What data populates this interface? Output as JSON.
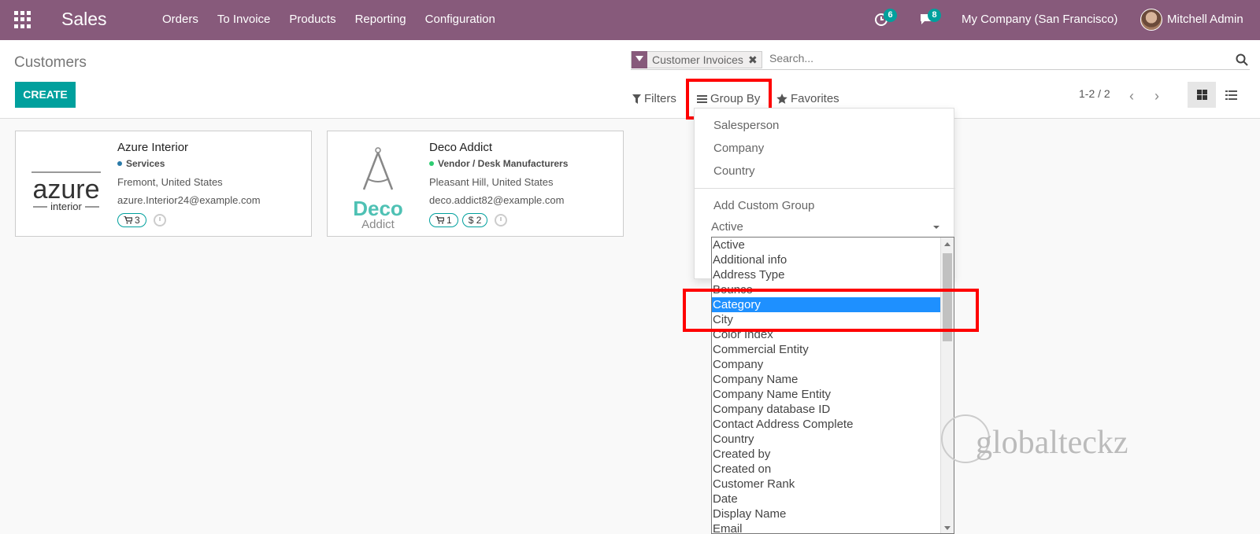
{
  "navbar": {
    "app_name": "Sales",
    "menu": [
      "Orders",
      "To Invoice",
      "Products",
      "Reporting",
      "Configuration"
    ],
    "activity_count": "6",
    "message_count": "8",
    "company": "My Company (San Francisco)",
    "user": "Mitchell Admin"
  },
  "control": {
    "breadcrumb": "Customers",
    "create_label": "CREATE",
    "facet_label": "Customer Invoices",
    "facet_remove": "✖",
    "search_placeholder": "Search...",
    "filters_label": "Filters",
    "groupby_label": "Group By",
    "favorites_label": "Favorites",
    "pager": "1-2 / 2",
    "pager_prev": "‹",
    "pager_next": "›"
  },
  "cards": [
    {
      "name": "Azure Interior",
      "tag": "Services",
      "tag_color": "#2a7aa8",
      "location": "Fremont, United States",
      "email": "azure.Interior24@example.com",
      "chips": [
        "3"
      ],
      "logo_text_top": "azure",
      "logo_text_bottom": "interior"
    },
    {
      "name": "Deco Addict",
      "tag": "Vendor / Desk Manufacturers",
      "tag_color": "#2ecc71",
      "location": "Pleasant Hill, United States",
      "email": "deco.addict82@example.com",
      "chips": [
        "1",
        "$ 2"
      ],
      "logo_text_top": "Deco",
      "logo_text_bottom": "Addict"
    }
  ],
  "groupby_menu": {
    "options": [
      "Salesperson",
      "Company",
      "Country"
    ],
    "add_custom": "Add Custom Group",
    "selected_field": "Active"
  },
  "field_list": {
    "options": [
      "Active",
      "Additional info",
      "Address Type",
      "Bounce",
      "Category",
      "City",
      "Color Index",
      "Commercial Entity",
      "Company",
      "Company Name",
      "Company Name Entity",
      "Company database ID",
      "Contact Address Complete",
      "Country",
      "Created by",
      "Created on",
      "Customer Rank",
      "Date",
      "Display Name",
      "Email"
    ],
    "highlighted": "Category"
  },
  "watermark": "globalteckz",
  "colors": {
    "brand": "#875a7b",
    "accent": "#00a09d",
    "highlight_box": "#ff0000",
    "selected_option": "#1e90ff"
  }
}
